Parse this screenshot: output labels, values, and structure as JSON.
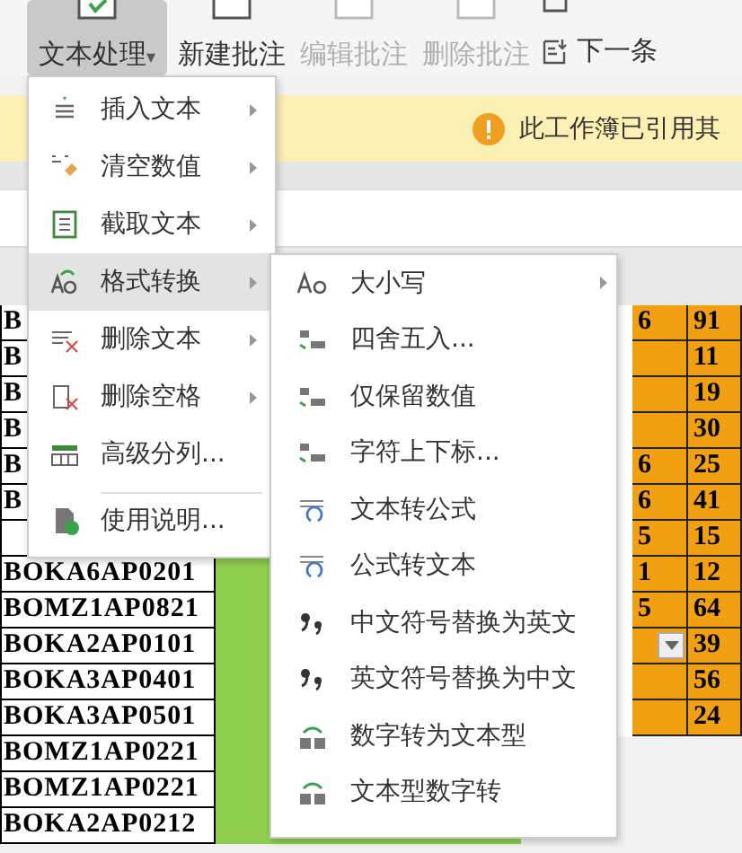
{
  "ribbon": {
    "buttons": [
      {
        "label": "文本处理",
        "caret": "▾",
        "kind": "dropdown",
        "selected": true,
        "disabled": false
      },
      {
        "label": "新建批注",
        "kind": "plain",
        "selected": false,
        "disabled": false
      },
      {
        "label": "编辑批注",
        "kind": "plain",
        "selected": false,
        "disabled": true
      },
      {
        "label": "删除批注",
        "kind": "plain",
        "selected": false,
        "disabled": true
      }
    ],
    "next": {
      "label": "下一条"
    }
  },
  "notice": {
    "text": "此工作簿已引用其"
  },
  "rows": [
    {
      "code": "B",
      "col_2": "6",
      "col_3": "91",
      "dropdown": false
    },
    {
      "code": "B",
      "col_2": "",
      "col_3": "11",
      "dropdown": false
    },
    {
      "code": "B",
      "col_2": "",
      "col_3": "19",
      "dropdown": false
    },
    {
      "code": "B",
      "col_2": "",
      "col_3": "30",
      "dropdown": false
    },
    {
      "code": "B",
      "col_2": "6",
      "col_3": "25",
      "dropdown": false
    },
    {
      "code": "B",
      "col_2": "6",
      "col_3": "41",
      "dropdown": false
    },
    {
      "col_2": "5",
      "col_3": "15",
      "dropdown": false
    },
    {
      "code": "BOKA6AP0201",
      "col_2": "1",
      "col_3": "12",
      "dropdown": false
    },
    {
      "code": "BOMZ1AP0821",
      "col_2": "5",
      "col_3": "64",
      "dropdown": false
    },
    {
      "code": "BOKA2AP0101",
      "col_2": "",
      "col_3": "39",
      "dropdown": true
    },
    {
      "code": "BOKA3AP0401",
      "col_2": "",
      "col_3": "56",
      "dropdown": false
    },
    {
      "code": "BOKA3AP0501",
      "col_2": "",
      "col_3": "24",
      "dropdown": false
    },
    {
      "code": "BOMZ1AP0221"
    },
    {
      "code": "BOMZ1AP0221"
    },
    {
      "code": "BOKA2AP0212"
    }
  ],
  "menu": {
    "items": [
      {
        "label": "插入文本",
        "submenu": true,
        "selected": false,
        "separator_before": false
      },
      {
        "label": "清空数值",
        "submenu": true,
        "selected": false,
        "separator_before": false
      },
      {
        "label": "截取文本",
        "submenu": true,
        "selected": false,
        "separator_before": false
      },
      {
        "label": "格式转换",
        "submenu": true,
        "selected": true,
        "separator_before": false
      },
      {
        "label": "删除文本",
        "submenu": true,
        "selected": false,
        "separator_before": false
      },
      {
        "label": "删除空格",
        "submenu": true,
        "selected": false,
        "separator_before": false
      },
      {
        "label": "高级分列...",
        "submenu": false,
        "selected": false,
        "separator_before": false
      },
      {
        "label": "使用说明...",
        "submenu": false,
        "selected": false,
        "separator_before": true
      }
    ]
  },
  "submenu": {
    "items": [
      {
        "label": "大小写",
        "submenu": true
      },
      {
        "label": "四舍五入...",
        "submenu": false
      },
      {
        "label": "仅保留数值",
        "submenu": false
      },
      {
        "label": "字符上下标...",
        "submenu": false
      },
      {
        "label": "文本转公式",
        "submenu": false
      },
      {
        "label": "公式转文本",
        "submenu": false
      },
      {
        "label": "中文符号替换为英文",
        "submenu": false
      },
      {
        "label": "英文符号替换为中文",
        "submenu": false
      },
      {
        "label": "数字转为文本型",
        "submenu": false
      },
      {
        "label": "文本型数字转",
        "submenu": false
      }
    ]
  }
}
